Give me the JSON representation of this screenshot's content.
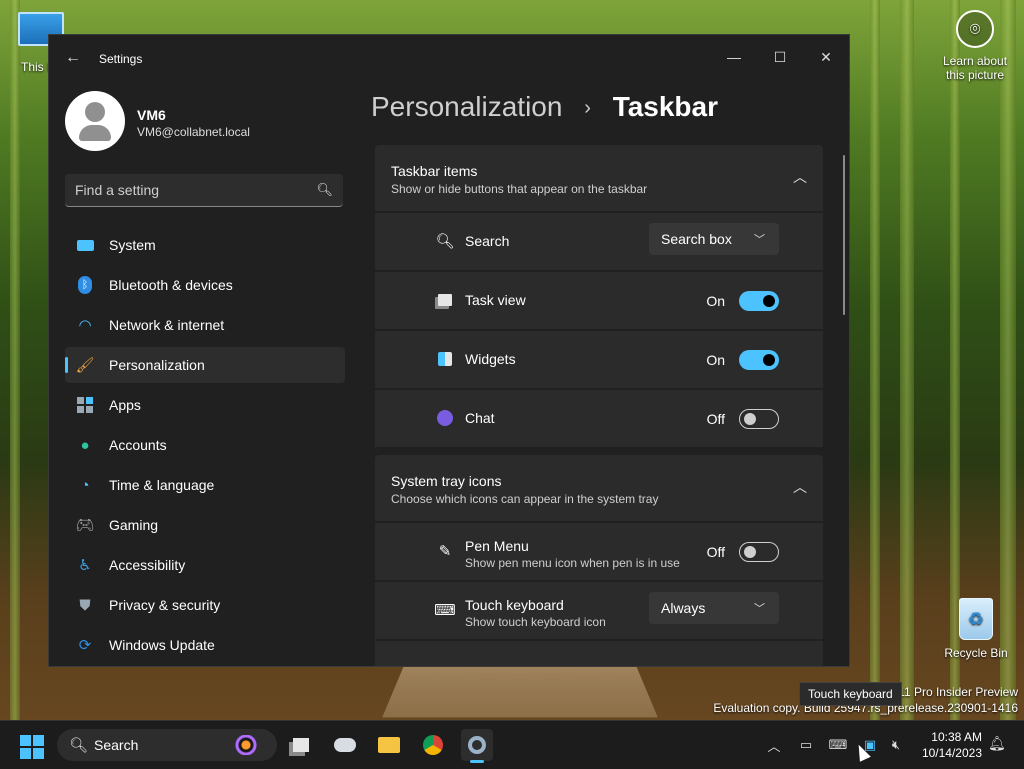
{
  "desktop": {
    "this_pc_label": "This P",
    "learn_label": "Learn about this picture",
    "recycle_bin_label": "Recycle Bin",
    "watermark_line1": "s 11 Pro Insider Preview",
    "watermark_line2": "Evaluation copy. Build 25947.rs_prerelease.230901-1416",
    "tooltip": "Touch keyboard"
  },
  "window": {
    "title": "Settings",
    "controls": {
      "minimize": "—",
      "maximize": "☐",
      "close": "✕"
    }
  },
  "profile": {
    "name": "VM6",
    "email": "VM6@collabnet.local"
  },
  "search": {
    "placeholder": "Find a setting"
  },
  "nav": {
    "items": [
      {
        "label": "System",
        "icon": "monitor-icon",
        "color": "#4cc2ff"
      },
      {
        "label": "Bluetooth & devices",
        "icon": "bluetooth-icon",
        "color": "#2f8de4"
      },
      {
        "label": "Network & internet",
        "icon": "wifi-icon",
        "color": "#4cc2ff"
      },
      {
        "label": "Personalization",
        "icon": "brush-icon",
        "color": "#e8a33c",
        "active": true
      },
      {
        "label": "Apps",
        "icon": "apps-icon",
        "color": "#9aa7b4"
      },
      {
        "label": "Accounts",
        "icon": "person-icon",
        "color": "#2ec4a0"
      },
      {
        "label": "Time & language",
        "icon": "globe-clock-icon",
        "color": "#4cc2ff"
      },
      {
        "label": "Gaming",
        "icon": "gamepad-icon",
        "color": "#b0b0b0"
      },
      {
        "label": "Accessibility",
        "icon": "accessibility-icon",
        "color": "#3aa0e8"
      },
      {
        "label": "Privacy & security",
        "icon": "shield-icon",
        "color": "#9aa7b4"
      },
      {
        "label": "Windows Update",
        "icon": "update-icon",
        "color": "#2f8de4"
      }
    ]
  },
  "breadcrumb": {
    "parent": "Personalization",
    "separator": "›",
    "current": "Taskbar"
  },
  "taskbar_items": {
    "title": "Taskbar items",
    "subtitle": "Show or hide buttons that appear on the taskbar",
    "rows": {
      "search": {
        "label": "Search",
        "value": "Search box"
      },
      "task_view": {
        "label": "Task view",
        "state": "On"
      },
      "widgets": {
        "label": "Widgets",
        "state": "On"
      },
      "chat": {
        "label": "Chat",
        "state": "Off"
      }
    }
  },
  "system_tray": {
    "title": "System tray icons",
    "subtitle": "Choose which icons can appear in the system tray",
    "rows": {
      "pen_menu": {
        "label": "Pen Menu",
        "sub": "Show pen menu icon when pen is in use",
        "state": "Off"
      },
      "touch_keyboard": {
        "label": "Touch keyboard",
        "sub": "Show touch keyboard icon",
        "value": "Always"
      }
    }
  },
  "taskbar": {
    "search_label": "Search",
    "time": "10:38 AM",
    "date": "10/14/2023"
  }
}
